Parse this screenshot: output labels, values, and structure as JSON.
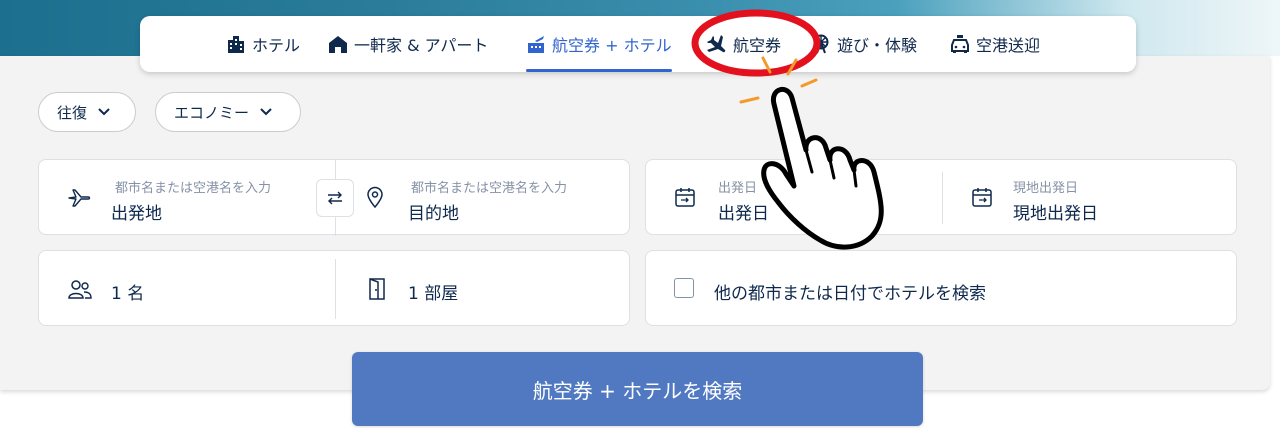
{
  "colors": {
    "accent": "#3264cf",
    "search_button": "#5079c1",
    "highlight_circle": "#e3101e",
    "burst": "#f39a2a",
    "text": "#0f294d",
    "muted": "#8592a6"
  },
  "tabs": [
    {
      "label": "ホテル",
      "icon": "hotel-building-icon",
      "active": false
    },
    {
      "label": "一軒家 & アパート",
      "icon": "house-icon",
      "active": false
    },
    {
      "label": "航空券 + ホテル",
      "icon": "flight-hotel-icon",
      "active": true
    },
    {
      "label": "航空券",
      "icon": "airplane-icon",
      "active": false,
      "highlighted": true
    },
    {
      "label": "遊び・体験",
      "icon": "ferris-wheel-icon",
      "active": false
    },
    {
      "label": "空港送迎",
      "icon": "car-icon",
      "active": false
    }
  ],
  "filters": {
    "trip_type": "往復",
    "cabin_class": "エコノミー"
  },
  "route": {
    "origin": {
      "placeholder": "都市名または空港名を入力",
      "value": "出発地",
      "icon": "airplane-icon"
    },
    "destination": {
      "placeholder": "都市名または空港名を入力",
      "value": "目的地",
      "icon": "map-pin-icon"
    },
    "swap_icon": "swap-arrows-icon"
  },
  "dates": {
    "depart": {
      "label": "出発日",
      "value": "出発日",
      "icon": "calendar-depart-icon"
    },
    "return": {
      "label": "現地出発日",
      "value": "現地出発日",
      "icon": "calendar-return-icon"
    }
  },
  "guests": {
    "travelers": {
      "value": "1 名",
      "icon": "people-icon"
    },
    "rooms": {
      "value": "1 部屋",
      "icon": "door-icon"
    }
  },
  "other_city_option": {
    "label": "他の都市または日付でホテルを検索",
    "checked": false
  },
  "search_button": {
    "label": "航空券 + ホテルを検索"
  }
}
